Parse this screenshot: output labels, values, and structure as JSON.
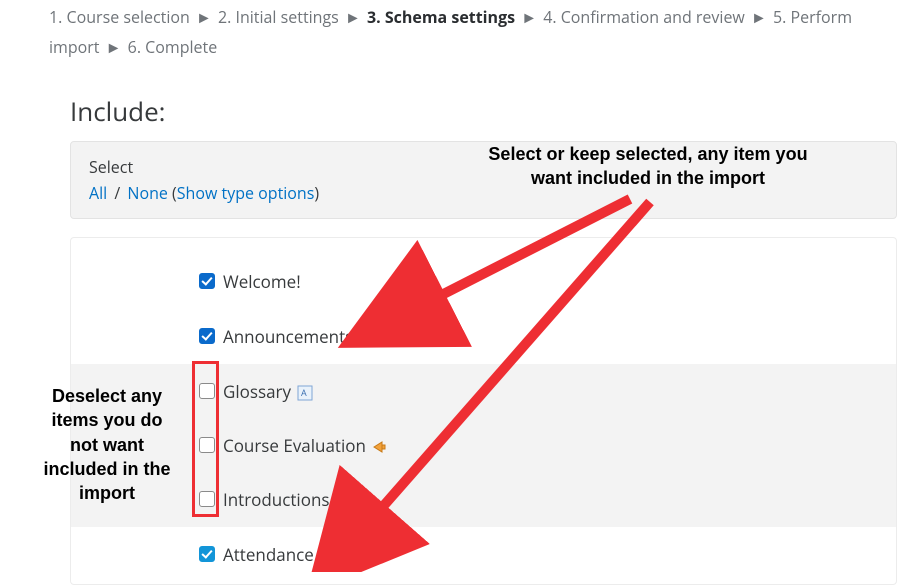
{
  "wizard": {
    "steps": [
      "1. Course selection",
      "2. Initial settings",
      "3. Schema settings",
      "4. Confirmation and review",
      "5. Perform import",
      "6. Complete"
    ],
    "current_index": 2,
    "separator": "►"
  },
  "include": {
    "heading": "Include:",
    "select_label": "Select",
    "link_all": "All",
    "link_none": "None",
    "link_show_type": "Show type options"
  },
  "items": [
    {
      "label": "Welcome!",
      "checked": true,
      "shaded": false,
      "icon": null
    },
    {
      "label": "Announcements",
      "checked": true,
      "shaded": false,
      "icon": "forum"
    },
    {
      "label": "Glossary",
      "checked": false,
      "shaded": true,
      "icon": "glossary"
    },
    {
      "label": "Course Evaluation",
      "checked": false,
      "shaded": true,
      "icon": "feedback"
    },
    {
      "label": "Introductions",
      "checked": false,
      "shaded": true,
      "icon": "forum"
    },
    {
      "label": "Attendance",
      "checked": true,
      "shaded": false,
      "icon": "attendance",
      "att": true
    }
  ],
  "annotations": {
    "select_text": "Select or keep selected, any item you want included in the import",
    "deselect_text": "Deselect any items you do not want included in the import"
  }
}
